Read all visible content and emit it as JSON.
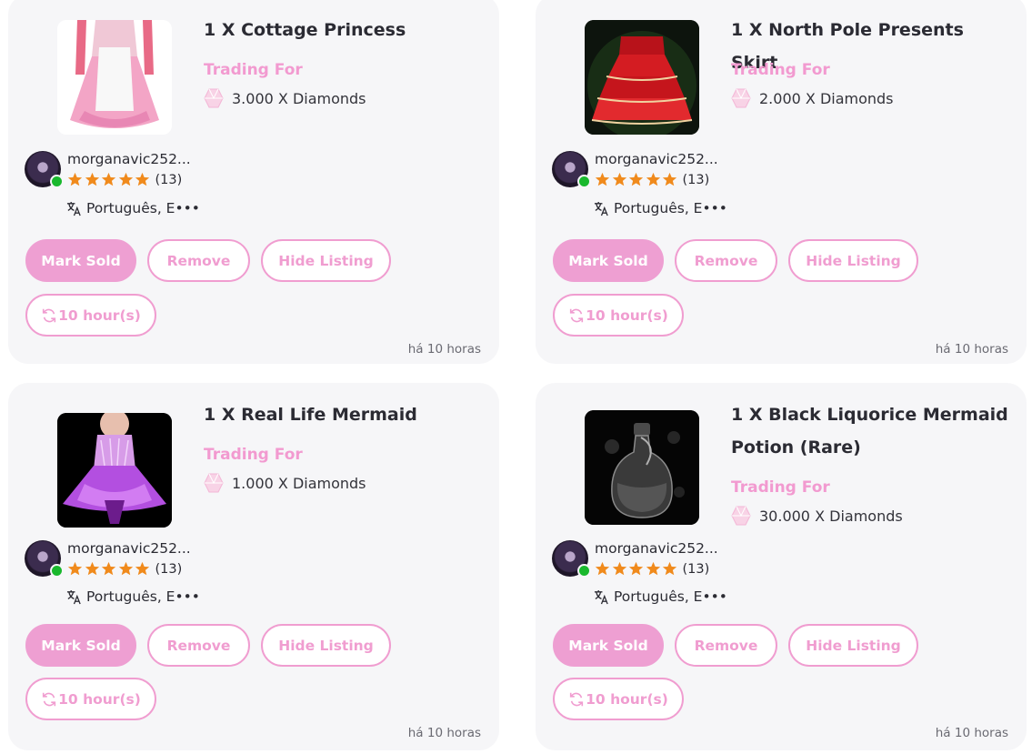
{
  "colors": {
    "accent": "#ee9fd2",
    "online": "#19b82d",
    "star": "#f08a1c",
    "card_bg": "#f6f6f8"
  },
  "listings": [
    {
      "title": "1 X Cottage Princess",
      "trading_label": "Trading For",
      "price": "3.000 X Diamonds",
      "seller": {
        "name": "morganavic252...",
        "rating_count": "(13)",
        "stars": 5,
        "online": true,
        "languages": "Português, E•••"
      },
      "buttons": {
        "mark_sold": "Mark Sold",
        "remove": "Remove",
        "hide": "Hide Listing",
        "refresh": "10 hour(s)"
      },
      "time_ago": "há 10 horas",
      "thumbnail_icon": "pink-dress-thumbnail"
    },
    {
      "title": "1 X North Pole Presents Skirt",
      "trading_label": "Trading For",
      "price": "2.000 X Diamonds",
      "seller": {
        "name": "morganavic252...",
        "rating_count": "(13)",
        "stars": 5,
        "online": true,
        "languages": "Português, E•••"
      },
      "buttons": {
        "mark_sold": "Mark Sold",
        "remove": "Remove",
        "hide": "Hide Listing",
        "refresh": "10 hour(s)"
      },
      "time_ago": "há 10 horas",
      "thumbnail_icon": "red-skirt-thumbnail"
    },
    {
      "title": "1 X Real Life Mermaid",
      "trading_label": "Trading For",
      "price": "1.000 X Diamonds",
      "seller": {
        "name": "morganavic252...",
        "rating_count": "(13)",
        "stars": 5,
        "online": true,
        "languages": "Português, E•••"
      },
      "buttons": {
        "mark_sold": "Mark Sold",
        "remove": "Remove",
        "hide": "Hide Listing",
        "refresh": "10 hour(s)"
      },
      "time_ago": "há 10 horas",
      "thumbnail_icon": "mermaid-dress-thumbnail"
    },
    {
      "title": "1 X Black Liquorice Mermaid Potion (Rare)",
      "trading_label": "Trading For",
      "price": "30.000 X Diamonds",
      "seller": {
        "name": "morganavic252...",
        "rating_count": "(13)",
        "stars": 5,
        "online": true,
        "languages": "Português, E•••"
      },
      "buttons": {
        "mark_sold": "Mark Sold",
        "remove": "Remove",
        "hide": "Hide Listing",
        "refresh": "10 hour(s)"
      },
      "time_ago": "há 10 horas",
      "thumbnail_icon": "potion-bottle-thumbnail"
    }
  ]
}
